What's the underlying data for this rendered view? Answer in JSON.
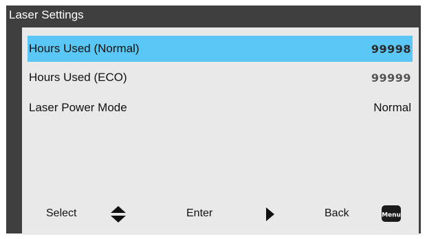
{
  "title": "Laser Settings",
  "rows": [
    {
      "label": "Hours Used (Normal)",
      "value": "99998",
      "selected": true
    },
    {
      "label": "Hours Used (ECO)",
      "value": "99999",
      "selected": false
    },
    {
      "label": "Laser Power Mode",
      "value": "Normal",
      "selected": false
    }
  ],
  "footer": {
    "select_label": "Select",
    "enter_label": "Enter",
    "back_label": "Back",
    "select_icon": "up-down-arrows-icon",
    "enter_icon": "right-triangle-icon",
    "back_icon": "menu-key-icon",
    "menu_key_text": "Menu"
  },
  "colors": {
    "frame": "#3f3f3f",
    "panel": "#e9e9e9",
    "selection": "#5ac7f7",
    "title_text": "#ffffff"
  }
}
